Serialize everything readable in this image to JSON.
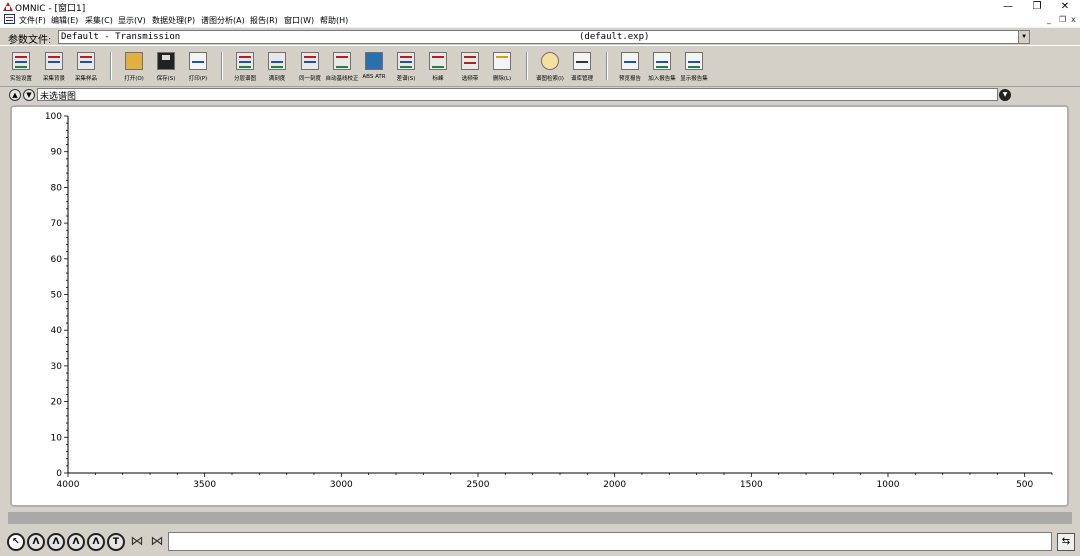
{
  "window": {
    "title": "OMNIC - [窗口1]",
    "controls": {
      "minimize": "—",
      "restore": "❐",
      "close": "✕"
    }
  },
  "menu": {
    "items": [
      "文件(F)",
      "编辑(E)",
      "采集(C)",
      "显示(V)",
      "数据处理(P)",
      "谱图分析(A)",
      "报告(R)",
      "窗口(W)",
      "帮助(H)"
    ],
    "mdi_controls": {
      "minimize": "_",
      "restore": "❐",
      "close": "x"
    }
  },
  "experiment": {
    "label": "参数文件:",
    "value": "Default - Transmission",
    "file": "(default.exp)"
  },
  "toolbar": {
    "buttons": [
      {
        "label": "实验设置",
        "icon": "experiment-setup-icon"
      },
      {
        "label": "采集背景",
        "icon": "collect-background-icon"
      },
      {
        "label": "采集样品",
        "icon": "collect-sample-icon"
      },
      {
        "label": "打开(O)",
        "icon": "open-folder-icon"
      },
      {
        "label": "保存(S)",
        "icon": "save-disk-icon"
      },
      {
        "label": "打印(P)",
        "icon": "printer-icon"
      },
      {
        "label": "分层谱图",
        "icon": "stack-spectra-icon"
      },
      {
        "label": "满刻度",
        "icon": "full-scale-icon"
      },
      {
        "label": "同一刻度",
        "icon": "common-scale-icon"
      },
      {
        "label": "自动基线校正",
        "icon": "baseline-correct-icon"
      },
      {
        "label": "ABS ATR",
        "icon": "abs-atr-icon"
      },
      {
        "label": "差谱(S)",
        "icon": "subtract-icon"
      },
      {
        "label": "标峰",
        "icon": "find-peaks-icon"
      },
      {
        "label": "选频带",
        "icon": "select-band-icon"
      },
      {
        "label": "删除(L)",
        "icon": "delete-icon"
      },
      {
        "label": "谱图检索(I)",
        "icon": "search-icon"
      },
      {
        "label": "谱库管理",
        "icon": "library-manager-icon"
      },
      {
        "label": "预览报告",
        "icon": "preview-report-icon"
      },
      {
        "label": "加入报告集",
        "icon": "add-to-notebook-icon"
      },
      {
        "label": "显示报告集",
        "icon": "view-notebook-icon"
      }
    ]
  },
  "spectrum_selector": {
    "value": "未选谱图"
  },
  "plot": {
    "y_ticks": [
      "100",
      "90",
      "80",
      "70",
      "60",
      "50",
      "40",
      "30",
      "20",
      "10",
      "0"
    ],
    "x_ticks": [
      "4000",
      "3500",
      "3000",
      "2500",
      "2000",
      "1500",
      "1000",
      "500"
    ],
    "x_range": [
      4000,
      400
    ],
    "y_range": [
      0,
      100
    ]
  },
  "bottom_tools": [
    {
      "name": "selection-tool-icon",
      "glyph": "↖"
    },
    {
      "name": "region-tool-icon",
      "glyph": "Λ"
    },
    {
      "name": "peak-height-tool-icon",
      "glyph": "Λ"
    },
    {
      "name": "peak-area-tool-icon",
      "glyph": "Λ"
    },
    {
      "name": "baseline-tool-icon",
      "glyph": "Λ"
    },
    {
      "name": "text-tool-icon",
      "glyph": "T"
    },
    {
      "name": "zoom-in-tool-icon",
      "glyph": "⋈"
    },
    {
      "name": "zoom-out-tool-icon",
      "glyph": "⋈"
    }
  ]
}
